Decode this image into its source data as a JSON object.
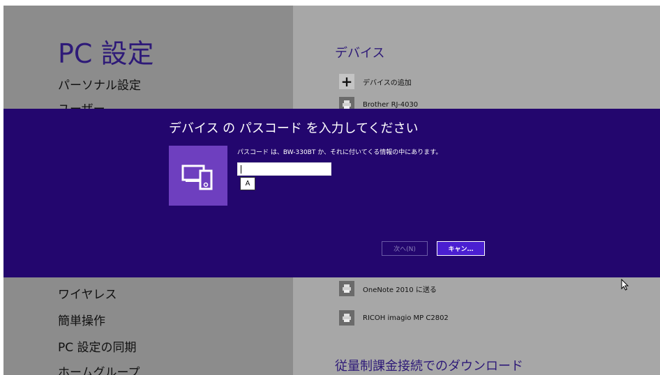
{
  "left_pane": {
    "title": "PC 設定",
    "items": [
      "パーソナル設定",
      "ユーザー",
      "ワイヤレス",
      "簡単操作",
      "PC 設定の同期",
      "ホームグループ"
    ]
  },
  "right_pane": {
    "section_devices": "デバイス",
    "add_device": "デバイスの追加",
    "devices": [
      "Brother RJ-4030",
      "OneNote 2010 に送る",
      "RICOH imagio MP C2802"
    ],
    "section_metered": "従量制課金接続でのダウンロード"
  },
  "dialog": {
    "title": "デバイス の パスコード を入力してください",
    "hint": "パスコード は、BW-330BT か、それに付いてくる情報の中にあります。",
    "passcode_value": "",
    "ime_mode": "A",
    "next_label": "次へ(N)",
    "cancel_label": "キャン…"
  },
  "colors": {
    "dialog_bg": "#23066e",
    "accent_tile": "#6e3fbf",
    "title_text": "#2e1a78"
  }
}
